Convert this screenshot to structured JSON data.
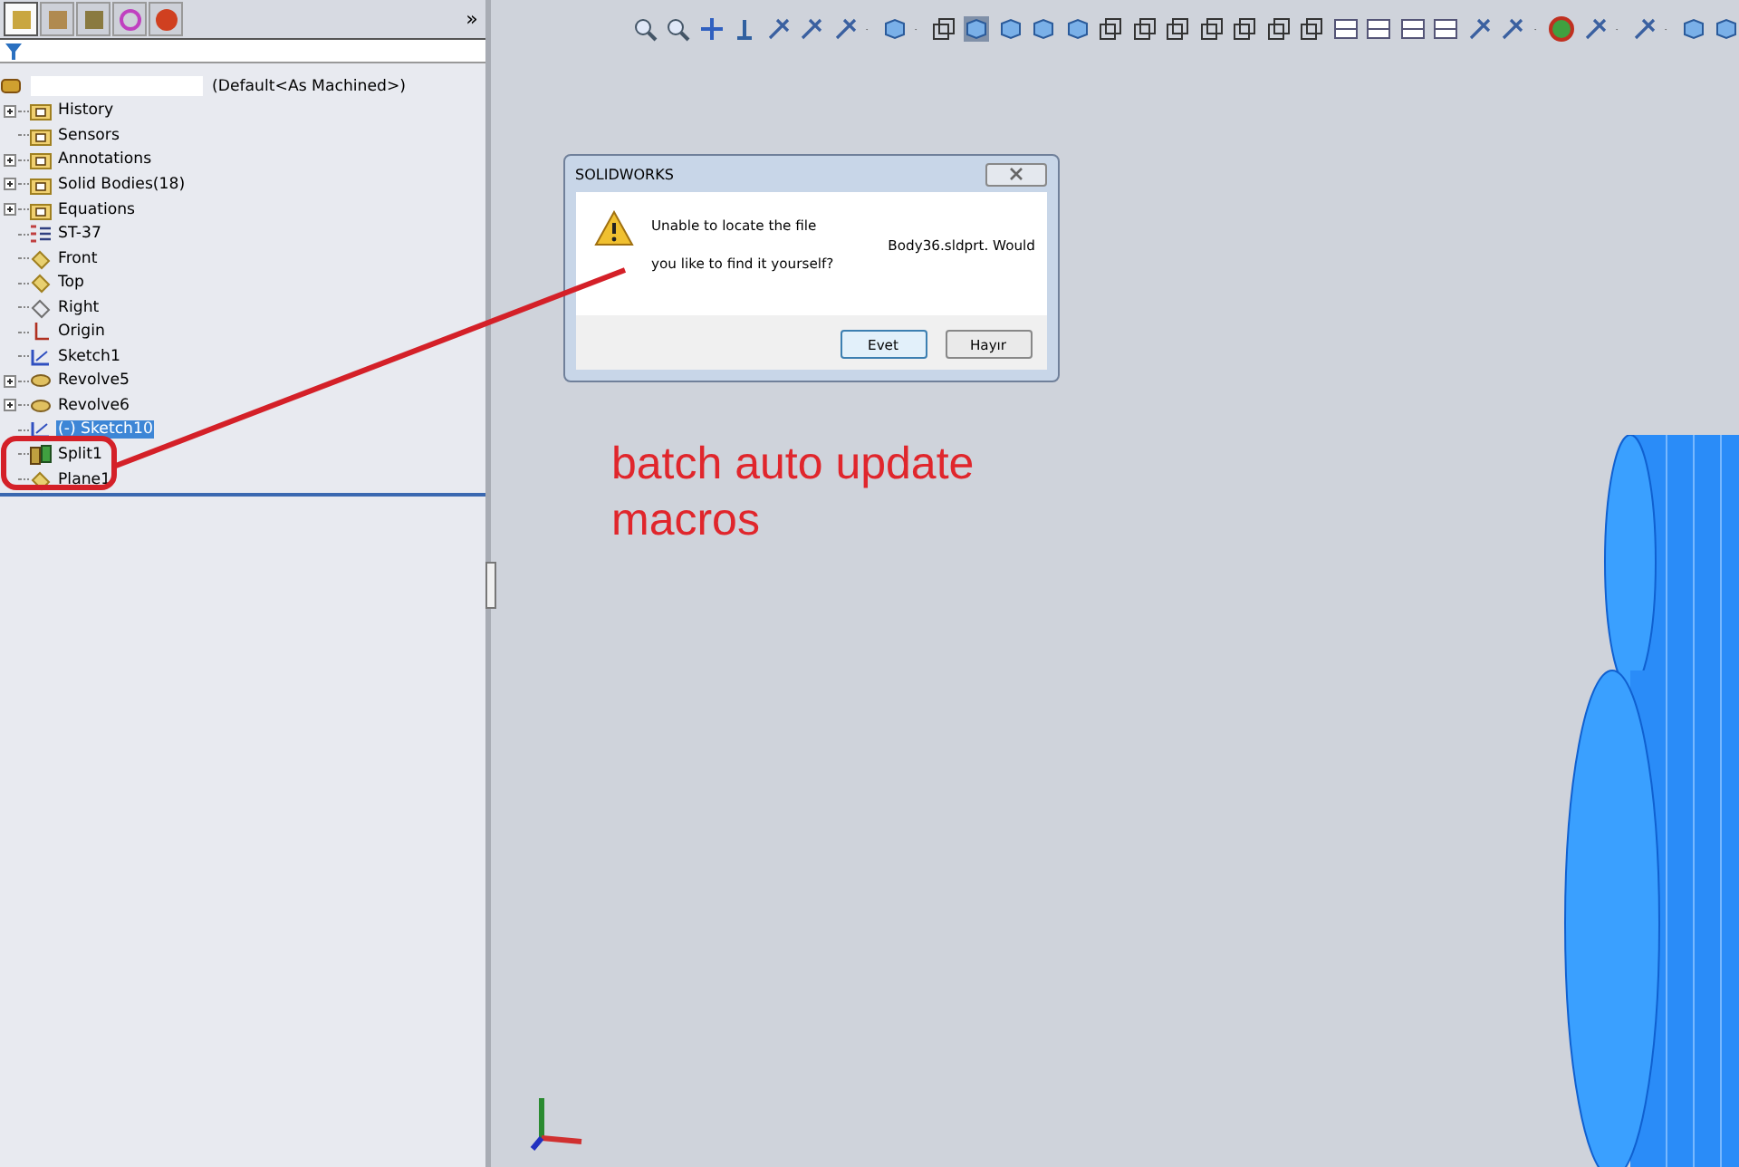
{
  "panel": {
    "tabs": [
      {
        "kind": "feature",
        "selected": true
      },
      {
        "kind": "property",
        "selected": false
      },
      {
        "kind": "config",
        "selected": false
      },
      {
        "kind": "dimxpert",
        "selected": false
      },
      {
        "kind": "display",
        "selected": false
      }
    ],
    "more": "»"
  },
  "tree": {
    "root": {
      "label": "(Default<As Machined>)"
    },
    "items": [
      {
        "label": "History",
        "kind": "history",
        "expandable": true,
        "selected": false
      },
      {
        "label": "Sensors",
        "kind": "sensor",
        "expandable": false,
        "selected": false
      },
      {
        "label": "Annotations",
        "kind": "annotation",
        "expandable": true,
        "selected": false
      },
      {
        "label": "Solid Bodies(18)",
        "kind": "bodies",
        "expandable": true,
        "selected": false
      },
      {
        "label": "Equations",
        "kind": "equation",
        "expandable": true,
        "selected": false
      },
      {
        "label": "ST-37",
        "kind": "material",
        "expandable": false,
        "selected": false
      },
      {
        "label": "Front",
        "kind": "plane",
        "expandable": false,
        "selected": false
      },
      {
        "label": "Top",
        "kind": "plane",
        "expandable": false,
        "selected": false
      },
      {
        "label": "Right",
        "kind": "plane-outline",
        "expandable": false,
        "selected": false
      },
      {
        "label": "Origin",
        "kind": "origin",
        "expandable": false,
        "selected": false
      },
      {
        "label": "Sketch1",
        "kind": "sketch",
        "expandable": false,
        "selected": false
      },
      {
        "label": "Revolve5",
        "kind": "revolve",
        "expandable": true,
        "selected": false
      },
      {
        "label": "Revolve6",
        "kind": "revolve",
        "expandable": true,
        "selected": false
      },
      {
        "label": "(-) Sketch10",
        "kind": "sketch",
        "expandable": false,
        "selected": true
      },
      {
        "label": "Split1",
        "kind": "split",
        "expandable": false,
        "selected": false
      },
      {
        "label": "Plane1",
        "kind": "plane",
        "expandable": false,
        "selected": false
      }
    ]
  },
  "dialog": {
    "title": "SOLIDWORKS",
    "message_lines": [
      "Unable to locate the file",
      "Body36.sldprt.  Would",
      "you like to find it yourself?"
    ],
    "buttons": [
      {
        "label": "Evet",
        "default": true
      },
      {
        "label": "Hayır",
        "default": false
      }
    ]
  },
  "annotation": {
    "text_lines": [
      "batch auto update",
      "macros"
    ]
  }
}
